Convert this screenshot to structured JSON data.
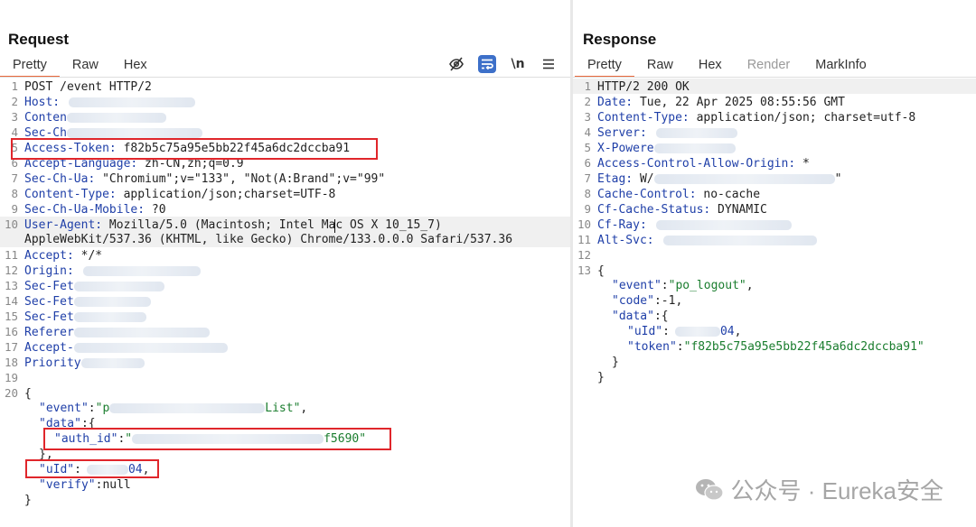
{
  "request": {
    "title": "Request",
    "tabs": [
      "Pretty",
      "Raw",
      "Hex"
    ],
    "tools": {
      "hide_icon": "eye-off-icon",
      "wrap_icon": "wrap-lines-icon",
      "newline_label": "\\n",
      "menu_icon": "menu-icon"
    },
    "lines": [
      {
        "n": "1",
        "text": "POST /event HTTP/2"
      },
      {
        "n": "2",
        "name": "Host:"
      },
      {
        "n": "3",
        "name": "Conten"
      },
      {
        "n": "4",
        "name": "Sec-Ch"
      },
      {
        "n": "5",
        "name": "Access-Token:",
        "value": " f82b5c75a95e5bb22f45a6dc2dccba91"
      },
      {
        "n": "6",
        "name": "Accept-Language:",
        "value": " zh-CN,zh;q=0.9"
      },
      {
        "n": "7",
        "name": "Sec-Ch-Ua:",
        "value": " \"Chromium\";v=\"133\", \"Not(A:Brand\";v=\"99\""
      },
      {
        "n": "8",
        "name": "Content-Type:",
        "value": " application/json;charset=UTF-8"
      },
      {
        "n": "9",
        "name": "Sec-Ch-Ua-Mobile:",
        "value": " ?0"
      },
      {
        "n": "10",
        "name": "User-Agent:",
        "value": " Mozilla/5.0 (Macintosh; Intel Mac OS X 10_15_7)"
      },
      {
        "n": "",
        "value": "AppleWebKit/537.36 (KHTML, like Gecko) Chrome/133.0.0.0 Safari/537.36"
      },
      {
        "n": "11",
        "name": "Accept:",
        "value": " */*"
      },
      {
        "n": "12",
        "name": "Origin:"
      },
      {
        "n": "13",
        "name": "Sec-Fet"
      },
      {
        "n": "14",
        "name": "Sec-Fet"
      },
      {
        "n": "15",
        "name": "Sec-Fet"
      },
      {
        "n": "16",
        "name": "Referer"
      },
      {
        "n": "17",
        "name": "Accept-"
      },
      {
        "n": "18",
        "name": "Priority"
      },
      {
        "n": "19"
      },
      {
        "n": "20",
        "text": "{"
      }
    ],
    "body": {
      "event_key": "\"event\"",
      "event_prefix": "\"p",
      "event_suffix": "List\"",
      "data_key": "\"data\"",
      "auth_key": "\"auth_id\"",
      "auth_prefix": "\"",
      "auth_suffix": "f5690\"",
      "close_brace": "},",
      "uid_key": "\"uId\"",
      "uid_suffix": "04",
      "verify_key": "\"verify\"",
      "verify_val": "null",
      "end": "}"
    }
  },
  "response": {
    "title": "Response",
    "tabs": [
      "Pretty",
      "Raw",
      "Hex",
      "Render",
      "MarkInfo"
    ],
    "lines": [
      {
        "n": "1",
        "text": "HTTP/2 200 OK"
      },
      {
        "n": "2",
        "name": "Date:",
        "value": " Tue, 22 Apr 2025 08:55:56 GMT"
      },
      {
        "n": "3",
        "name": "Content-Type:",
        "value": " application/json; charset=utf-8"
      },
      {
        "n": "4",
        "name": "Server:"
      },
      {
        "n": "5",
        "name": "X-Powere"
      },
      {
        "n": "6",
        "name": "Access-Control-Allow-Origin:",
        "value": " *"
      },
      {
        "n": "7",
        "name": "Etag:",
        "value": " W/"
      },
      {
        "n": "8",
        "name": "Cache-Control:",
        "value": " no-cache"
      },
      {
        "n": "9",
        "name": "Cf-Cache-Status:",
        "value": " DYNAMIC"
      },
      {
        "n": "10",
        "name": "Cf-Ray:"
      },
      {
        "n": "11",
        "name": "Alt-Svc:"
      },
      {
        "n": "12"
      },
      {
        "n": "13",
        "text": "{"
      }
    ],
    "etag_end": "\"",
    "body": {
      "event_key": "\"event\"",
      "event_val": "\"po_logout\"",
      "code_key": "\"code\"",
      "code_val": "-1",
      "data_key": "\"data\"",
      "uid_key": "\"uId\"",
      "uid_suffix": "04",
      "token_key": "\"token\"",
      "token_val": "\"f82b5c75a95e5bb22f45a6dc2dccba91\"",
      "inner_close": "}",
      "end": "}"
    }
  },
  "watermark": {
    "text": "公众号 · Eureka安全",
    "icon": "wechat-icon"
  }
}
